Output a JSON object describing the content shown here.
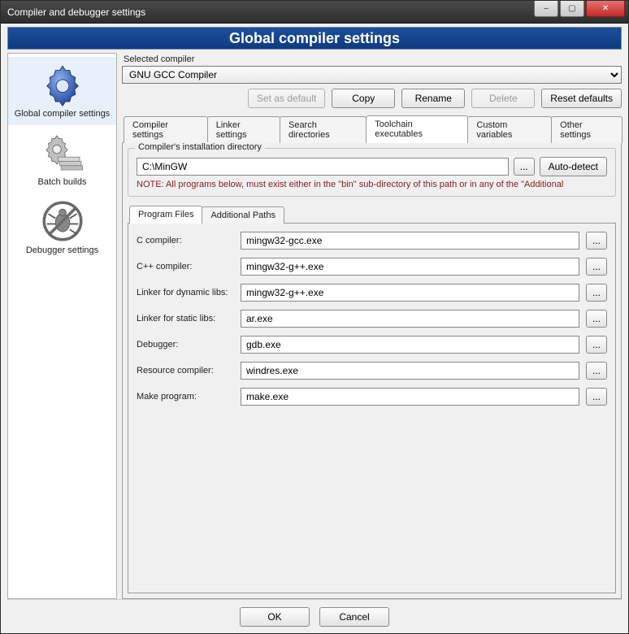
{
  "window": {
    "title": "Compiler and debugger settings",
    "minimize": "–",
    "maximize": "▢",
    "close": "✕"
  },
  "banner": "Global compiler settings",
  "sidebar": {
    "items": [
      {
        "label": "Global compiler settings"
      },
      {
        "label": "Batch builds"
      },
      {
        "label": "Debugger settings"
      }
    ]
  },
  "selected_compiler": {
    "label": "Selected compiler",
    "value": "GNU GCC Compiler",
    "buttons": {
      "set_default": "Set as default",
      "copy": "Copy",
      "rename": "Rename",
      "delete": "Delete",
      "reset": "Reset defaults"
    }
  },
  "tabs": [
    "Compiler settings",
    "Linker settings",
    "Search directories",
    "Toolchain executables",
    "Custom variables",
    "Other settings"
  ],
  "active_tab": "Toolchain executables",
  "install_dir": {
    "legend": "Compiler's installation directory",
    "value": "C:\\MinGW",
    "browse": "...",
    "auto_detect": "Auto-detect",
    "note": "NOTE: All programs below, must exist either in the \"bin\" sub-directory of this path or in any of the \"Additional"
  },
  "subtabs": [
    "Program Files",
    "Additional Paths"
  ],
  "active_subtab": "Program Files",
  "programs": {
    "rows": [
      {
        "label": "C compiler:",
        "value": "mingw32-gcc.exe"
      },
      {
        "label": "C++ compiler:",
        "value": "mingw32-g++.exe"
      },
      {
        "label": "Linker for dynamic libs:",
        "value": "mingw32-g++.exe"
      },
      {
        "label": "Linker for static libs:",
        "value": "ar.exe"
      },
      {
        "label": "Debugger:",
        "value": "gdb.exe"
      },
      {
        "label": "Resource compiler:",
        "value": "windres.exe"
      },
      {
        "label": "Make program:",
        "value": "make.exe"
      }
    ],
    "browse": "..."
  },
  "footer": {
    "ok": "OK",
    "cancel": "Cancel"
  }
}
